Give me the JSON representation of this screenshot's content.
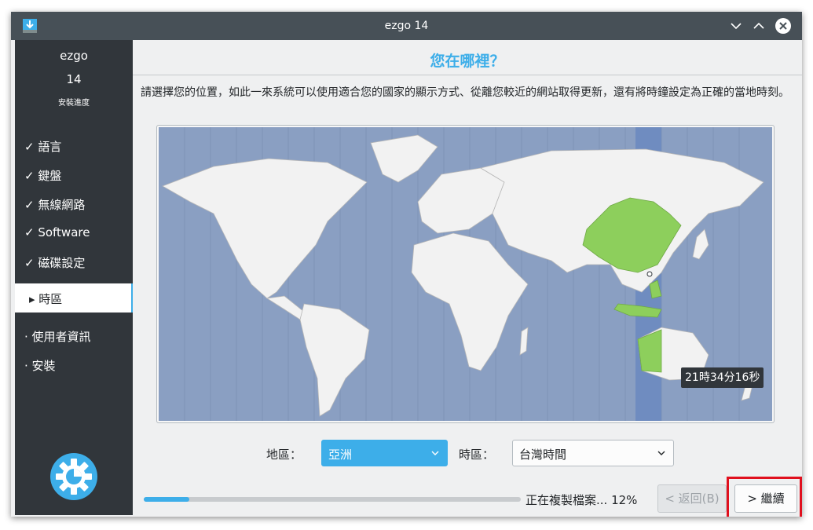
{
  "window": {
    "title": "ezgo 14"
  },
  "sidebar": {
    "brand_name": "ezgo",
    "brand_version": "14",
    "brand_subtitle": "安裝進度",
    "done_steps": [
      "✓ 語言",
      "✓ 鍵盤",
      "✓ 無線網路",
      "✓ Software",
      "✓ 磁碟設定"
    ],
    "active_step": "▸ 時區",
    "pending_steps": [
      "· 使用者資訊",
      "· 安裝"
    ]
  },
  "main": {
    "heading": "您在哪裡？",
    "description": "請選擇您的位置，如此一來系統可以使用適合您的國家的顯示方式、從離您較近的網站取得更新，還有將時鐘設定為正確的當地時刻。",
    "map": {
      "time_tooltip": "21時34分16秒"
    },
    "region_label": "地區：",
    "region_value": "亞洲",
    "timezone_label": "時區：",
    "timezone_value": "台灣時間",
    "status_text": "正在複製檔案... 12%",
    "progress_percent": 12,
    "back_button": "< 返回(B)",
    "continue_button": "> 繼續"
  },
  "colors": {
    "accent": "#3daee9",
    "sidebar_bg": "#31363b",
    "titlebar_bg": "#475057",
    "map_ocean": "#8a9fc2",
    "map_land": "#f2f2f2",
    "map_selected": "#8dcf5c",
    "highlight_box": "#e0101e"
  },
  "icons": [
    "app-installer-icon",
    "minimize-icon",
    "maximize-icon",
    "close-icon",
    "gear-logo-icon",
    "chevron-down-icon"
  ]
}
